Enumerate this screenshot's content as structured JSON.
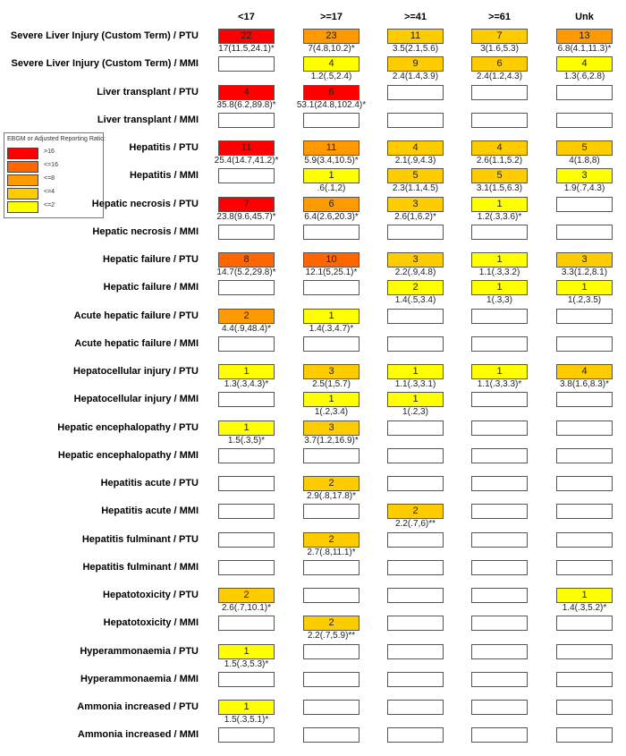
{
  "chart_data": {
    "type": "heatmap",
    "title": "",
    "legend": {
      "title": "EBGM or Adjusted Reporting Ratio:",
      "placement": "left",
      "bins": [
        {
          "label": ">16",
          "color": "#ff0000"
        },
        {
          "label": "<=16",
          "color": "#ff6600"
        },
        {
          "label": "<=8",
          "color": "#ff9900"
        },
        {
          "label": "<=4",
          "color": "#ffcc00"
        },
        {
          "label": "<=2",
          "color": "#ffff00"
        }
      ]
    },
    "columns": [
      "<17",
      ">=17",
      ">=41",
      ">=61",
      "Unk"
    ],
    "rows": [
      {
        "label": "Severe Liver Injury (Custom Term) / PTU",
        "cells": [
          {
            "count": "22",
            "stat": "17(11.5,24.1)*",
            "bin": 0
          },
          {
            "count": "23",
            "stat": "7(4.8,10.2)*",
            "bin": 2
          },
          {
            "count": "11",
            "stat": "3.5(2.1,5.6)",
            "bin": 3
          },
          {
            "count": "7",
            "stat": "3(1.6,5.3)",
            "bin": 3
          },
          {
            "count": "13",
            "stat": "6.8(4.1,11.3)*",
            "bin": 2
          }
        ]
      },
      {
        "label": "Severe Liver Injury (Custom Term) / MMI",
        "cells": [
          null,
          {
            "count": "4",
            "stat": "1.2(.5,2.4)",
            "bin": 4
          },
          {
            "count": "9",
            "stat": "2.4(1.4,3.9)",
            "bin": 3
          },
          {
            "count": "6",
            "stat": "2.4(1.2,4.3)",
            "bin": 3
          },
          {
            "count": "4",
            "stat": "1.3(.6,2.8)",
            "bin": 4
          }
        ]
      },
      {
        "label": "Liver transplant / PTU",
        "cells": [
          {
            "count": "4",
            "stat": "35.8(6.2,89.8)*",
            "bin": 0
          },
          {
            "count": "6",
            "stat": "53.1(24.8,102.4)*",
            "bin": 0
          },
          null,
          null,
          null
        ]
      },
      {
        "label": "Liver transplant / MMI",
        "cells": [
          null,
          null,
          null,
          null,
          null
        ]
      },
      {
        "label": "Hepatitis / PTU",
        "cells": [
          {
            "count": "11",
            "stat": "25.4(14.7,41.2)*",
            "bin": 0
          },
          {
            "count": "11",
            "stat": "5.9(3.4,10.5)*",
            "bin": 2
          },
          {
            "count": "4",
            "stat": "2.1(.9,4.3)",
            "bin": 3
          },
          {
            "count": "4",
            "stat": "2.6(1.1,5.2)",
            "bin": 3
          },
          {
            "count": "5",
            "stat": "4(1.8,8)",
            "bin": 3
          }
        ]
      },
      {
        "label": "Hepatitis / MMI",
        "cells": [
          null,
          {
            "count": "1",
            "stat": ".6(.1,2)",
            "bin": 4
          },
          {
            "count": "5",
            "stat": "2.3(1.1,4.5)",
            "bin": 3
          },
          {
            "count": "5",
            "stat": "3.1(1.5,6.3)",
            "bin": 3
          },
          {
            "count": "3",
            "stat": "1.9(.7,4.3)",
            "bin": 4
          }
        ]
      },
      {
        "label": "Hepatic necrosis / PTU",
        "cells": [
          {
            "count": "7",
            "stat": "23.8(9.6,45.7)*",
            "bin": 0
          },
          {
            "count": "6",
            "stat": "6.4(2.6,20.3)*",
            "bin": 2
          },
          {
            "count": "3",
            "stat": "2.6(1,6.2)*",
            "bin": 3
          },
          {
            "count": "1",
            "stat": "1.2(.3,3.6)*",
            "bin": 4
          },
          null
        ]
      },
      {
        "label": "Hepatic necrosis / MMI",
        "cells": [
          null,
          null,
          null,
          null,
          null
        ]
      },
      {
        "label": "Hepatic failure / PTU",
        "cells": [
          {
            "count": "8",
            "stat": "14.7(5.2,29.8)*",
            "bin": 1
          },
          {
            "count": "10",
            "stat": "12.1(5,25.1)*",
            "bin": 1
          },
          {
            "count": "3",
            "stat": "2.2(.9,4.8)",
            "bin": 3
          },
          {
            "count": "1",
            "stat": "1.1(.3,3.2)",
            "bin": 4
          },
          {
            "count": "3",
            "stat": "3.3(1.2,8.1)",
            "bin": 3
          }
        ]
      },
      {
        "label": "Hepatic failure / MMI",
        "cells": [
          null,
          null,
          {
            "count": "2",
            "stat": "1.4(.5,3.4)",
            "bin": 4
          },
          {
            "count": "1",
            "stat": "1(.3,3)",
            "bin": 4
          },
          {
            "count": "1",
            "stat": "1(.2,3.5)",
            "bin": 4
          }
        ]
      },
      {
        "label": "Acute hepatic failure / PTU",
        "cells": [
          {
            "count": "2",
            "stat": "4.4(.9,48.4)*",
            "bin": 2
          },
          {
            "count": "1",
            "stat": "1.4(.3,4.7)*",
            "bin": 4
          },
          null,
          null,
          null
        ]
      },
      {
        "label": "Acute hepatic failure / MMI",
        "cells": [
          null,
          null,
          null,
          null,
          null
        ]
      },
      {
        "label": "Hepatocellular injury / PTU",
        "cells": [
          {
            "count": "1",
            "stat": "1.3(.3,4.3)*",
            "bin": 4
          },
          {
            "count": "3",
            "stat": "2.5(1,5.7)",
            "bin": 3
          },
          {
            "count": "1",
            "stat": "1.1(.3,3.1)",
            "bin": 4
          },
          {
            "count": "1",
            "stat": "1.1(.3,3.3)*",
            "bin": 4
          },
          {
            "count": "4",
            "stat": "3.8(1.6,8.3)*",
            "bin": 3
          }
        ]
      },
      {
        "label": "Hepatocellular injury / MMI",
        "cells": [
          null,
          {
            "count": "1",
            "stat": "1(.2,3.4)",
            "bin": 4
          },
          {
            "count": "1",
            "stat": "1(.2,3)",
            "bin": 4
          },
          null,
          null
        ]
      },
      {
        "label": "Hepatic encephalopathy / PTU",
        "cells": [
          {
            "count": "1",
            "stat": "1.5(.3,5)*",
            "bin": 4
          },
          {
            "count": "3",
            "stat": "3.7(1.2,16.9)*",
            "bin": 3
          },
          null,
          null,
          null
        ]
      },
      {
        "label": "Hepatic encephalopathy / MMI",
        "cells": [
          null,
          null,
          null,
          null,
          null
        ]
      },
      {
        "label": "Hepatitis acute / PTU",
        "cells": [
          null,
          {
            "count": "2",
            "stat": "2.9(.8,17.8)*",
            "bin": 3
          },
          null,
          null,
          null
        ]
      },
      {
        "label": "Hepatitis acute / MMI",
        "cells": [
          null,
          null,
          {
            "count": "2",
            "stat": "2.2(.7,6)**",
            "bin": 3
          },
          null,
          null
        ]
      },
      {
        "label": "Hepatitis fulminant / PTU",
        "cells": [
          null,
          {
            "count": "2",
            "stat": "2.7(.8,11.1)*",
            "bin": 3
          },
          null,
          null,
          null
        ]
      },
      {
        "label": "Hepatitis fulminant / MMI",
        "cells": [
          null,
          null,
          null,
          null,
          null
        ]
      },
      {
        "label": "Hepatotoxicity / PTU",
        "cells": [
          {
            "count": "2",
            "stat": "2.6(.7,10.1)*",
            "bin": 3
          },
          null,
          null,
          null,
          {
            "count": "1",
            "stat": "1.4(.3,5.2)*",
            "bin": 4
          }
        ]
      },
      {
        "label": "Hepatotoxicity / MMI",
        "cells": [
          null,
          {
            "count": "2",
            "stat": "2.2(.7,5.9)**",
            "bin": 3
          },
          null,
          null,
          null
        ]
      },
      {
        "label": "Hyperammonaemia / PTU",
        "cells": [
          {
            "count": "1",
            "stat": "1.5(.3,5.3)*",
            "bin": 4
          },
          null,
          null,
          null,
          null
        ]
      },
      {
        "label": "Hyperammonaemia / MMI",
        "cells": [
          null,
          null,
          null,
          null,
          null
        ]
      },
      {
        "label": "Ammonia increased / PTU",
        "cells": [
          {
            "count": "1",
            "stat": "1.5(.3,5.1)*",
            "bin": 4
          },
          null,
          null,
          null,
          null
        ]
      },
      {
        "label": "Ammonia increased / MMI",
        "cells": [
          null,
          null,
          null,
          null,
          null
        ]
      }
    ]
  }
}
